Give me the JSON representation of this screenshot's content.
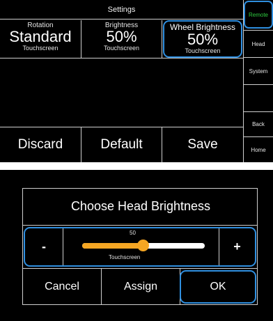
{
  "settings_screen": {
    "title": "Settings",
    "settings": [
      {
        "label": "Rotation",
        "value": "Standard",
        "source": "Touchscreen"
      },
      {
        "label": "Brightness",
        "value": "50%",
        "source": "Touchscreen"
      },
      {
        "label": "Wheel Brightness",
        "value": "50%",
        "source": "Touchscreen"
      }
    ],
    "sidebar": [
      "Remote",
      "Head",
      "System",
      "",
      "Back",
      "Home"
    ],
    "actions": {
      "discard": "Discard",
      "default": "Default",
      "save": "Save"
    }
  },
  "brightness_dialog": {
    "title": "Choose  Head  Brightness",
    "slider": {
      "value": "50",
      "level": 0.5,
      "caption": "Touchscreen",
      "minus": "-",
      "plus": "+"
    },
    "actions": {
      "cancel": "Cancel",
      "assign": "Assign",
      "ok": "OK"
    }
  },
  "colors": {
    "highlight": "#2f8fe0",
    "active_sidebar": "#2ecc40",
    "slider": "#f5a623"
  }
}
